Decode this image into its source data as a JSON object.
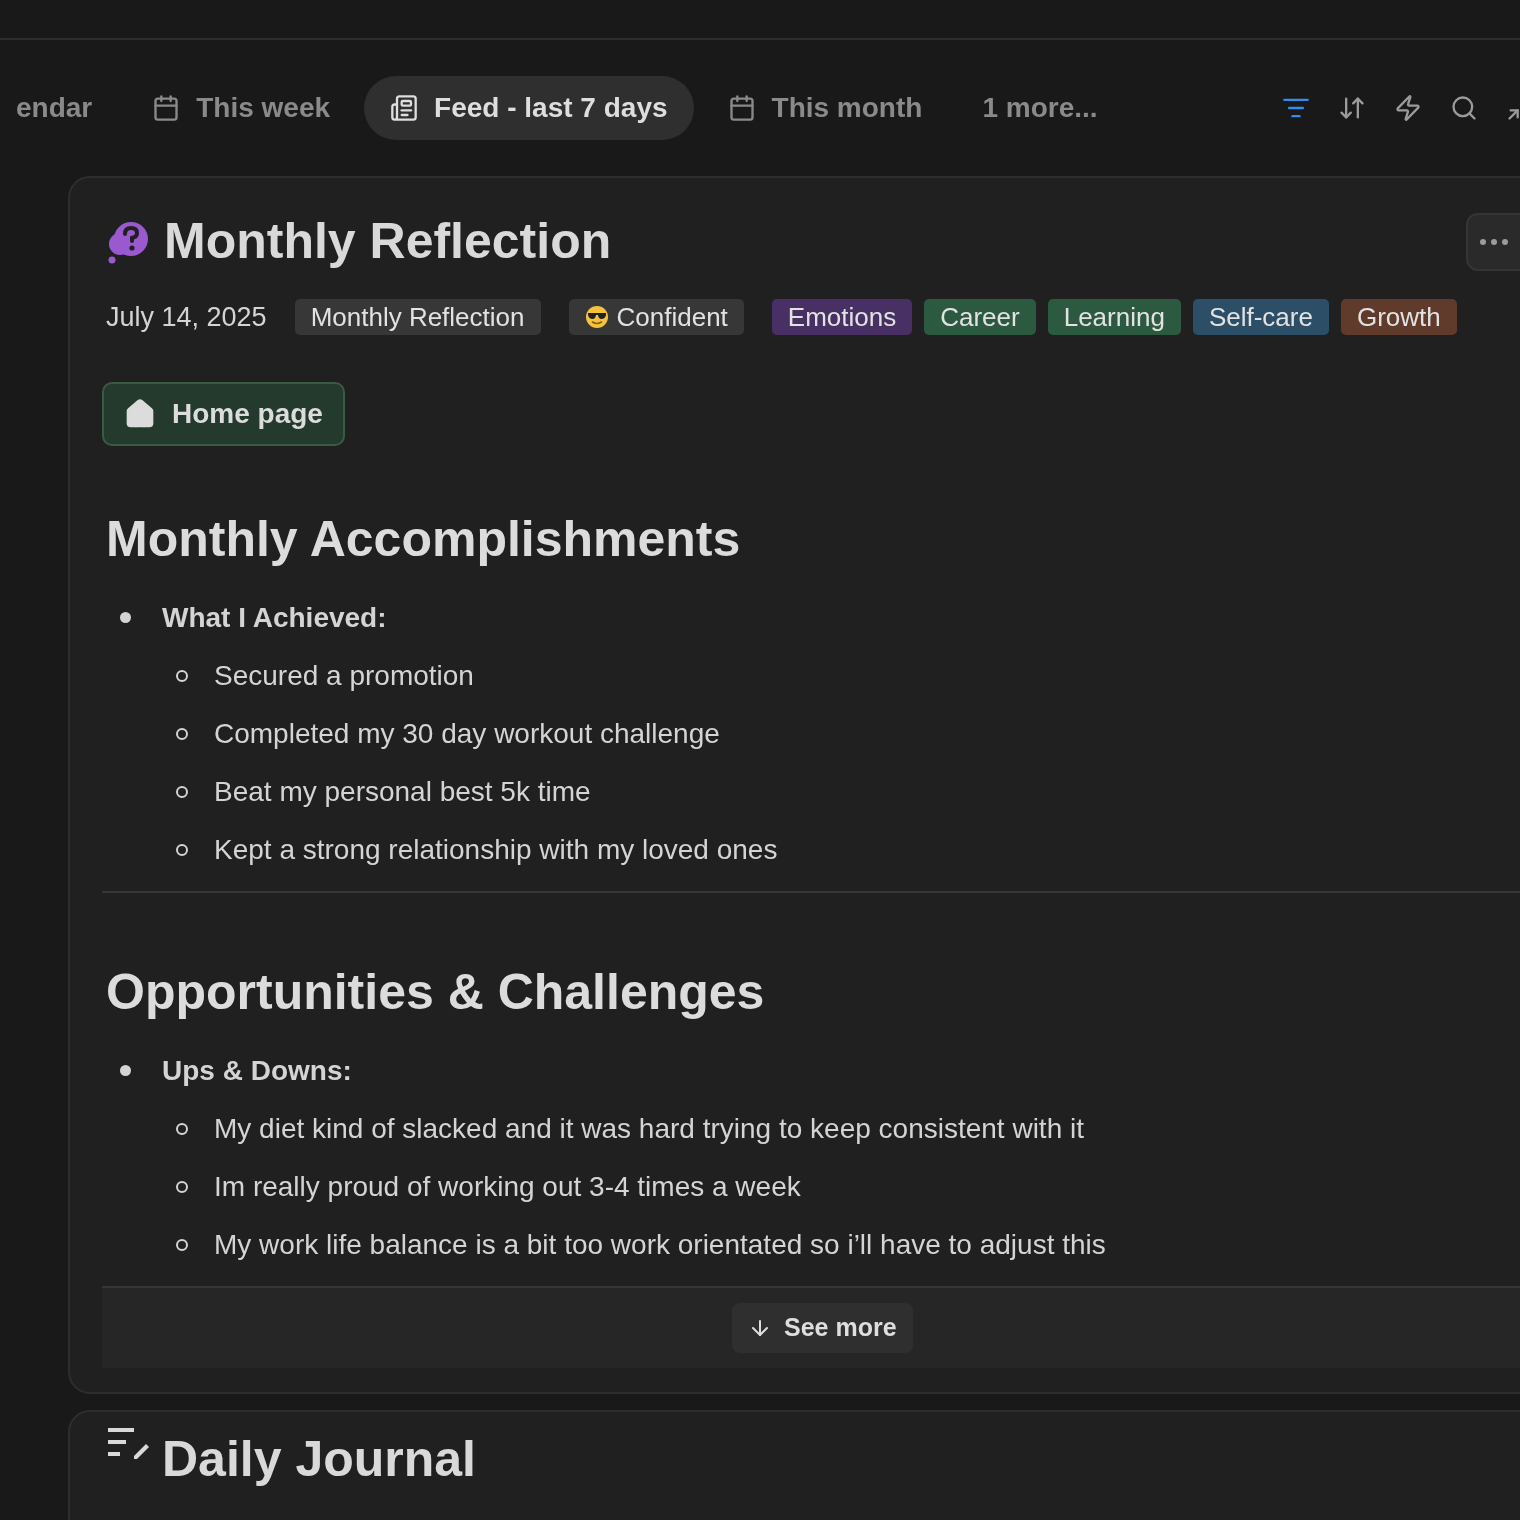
{
  "tabs": [
    {
      "label": "endar",
      "kind": "plain",
      "selected": false
    },
    {
      "label": "This week",
      "kind": "calendar",
      "selected": false
    },
    {
      "label": "Feed - last 7 days",
      "kind": "feed",
      "selected": true
    },
    {
      "label": "This month",
      "kind": "calendar",
      "selected": false
    },
    {
      "label": "1 more...",
      "kind": "plain",
      "selected": false
    }
  ],
  "toolbar": [
    {
      "kind": "filter",
      "active": true
    },
    {
      "kind": "sort",
      "active": false
    },
    {
      "kind": "bolt",
      "active": false
    },
    {
      "kind": "search",
      "active": false
    },
    {
      "kind": "expand",
      "active": false
    }
  ],
  "card": {
    "title": "Monthly Reflection",
    "date": "July 14, 2025",
    "tags": [
      {
        "label": "Monthly Reflection",
        "kind": "plain",
        "color": "#373737"
      },
      {
        "label": "Confident",
        "kind": "mood",
        "color": "#373737"
      },
      {
        "label": "Emotions",
        "kind": "plain",
        "color": "#493064"
      },
      {
        "label": "Career",
        "kind": "plain",
        "color": "#2b5a40"
      },
      {
        "label": "Learning",
        "kind": "plain",
        "color": "#2b5a40"
      },
      {
        "label": "Self-care",
        "kind": "plain",
        "color": "#2c4e66"
      },
      {
        "label": "Growth",
        "kind": "plain",
        "color": "#603b2c"
      }
    ],
    "link": "Home page",
    "sections": [
      {
        "heading": "Monthly Accomplishments",
        "items": [
          {
            "text": "What I Achieved:",
            "children": [
              {
                "text": "Secured a promotion"
              },
              {
                "text": "Completed my 30 day workout challenge"
              },
              {
                "text": "Beat my personal best 5k time"
              },
              {
                "text": "Kept a strong relationship with my loved ones"
              }
            ]
          }
        ]
      },
      {
        "heading": "Opportunities & Challenges",
        "items": [
          {
            "text": "Ups & Downs:",
            "children": [
              {
                "text": "My diet kind of slacked and it was hard trying to keep consistent with it"
              },
              {
                "text": "Im really proud of working out 3-4 times a week"
              },
              {
                "text": "My work life balance is a bit too work orientated so i’ll have to adjust this"
              }
            ]
          }
        ]
      }
    ],
    "see_more": "See more"
  },
  "next_card": {
    "title": "Daily Journal"
  }
}
